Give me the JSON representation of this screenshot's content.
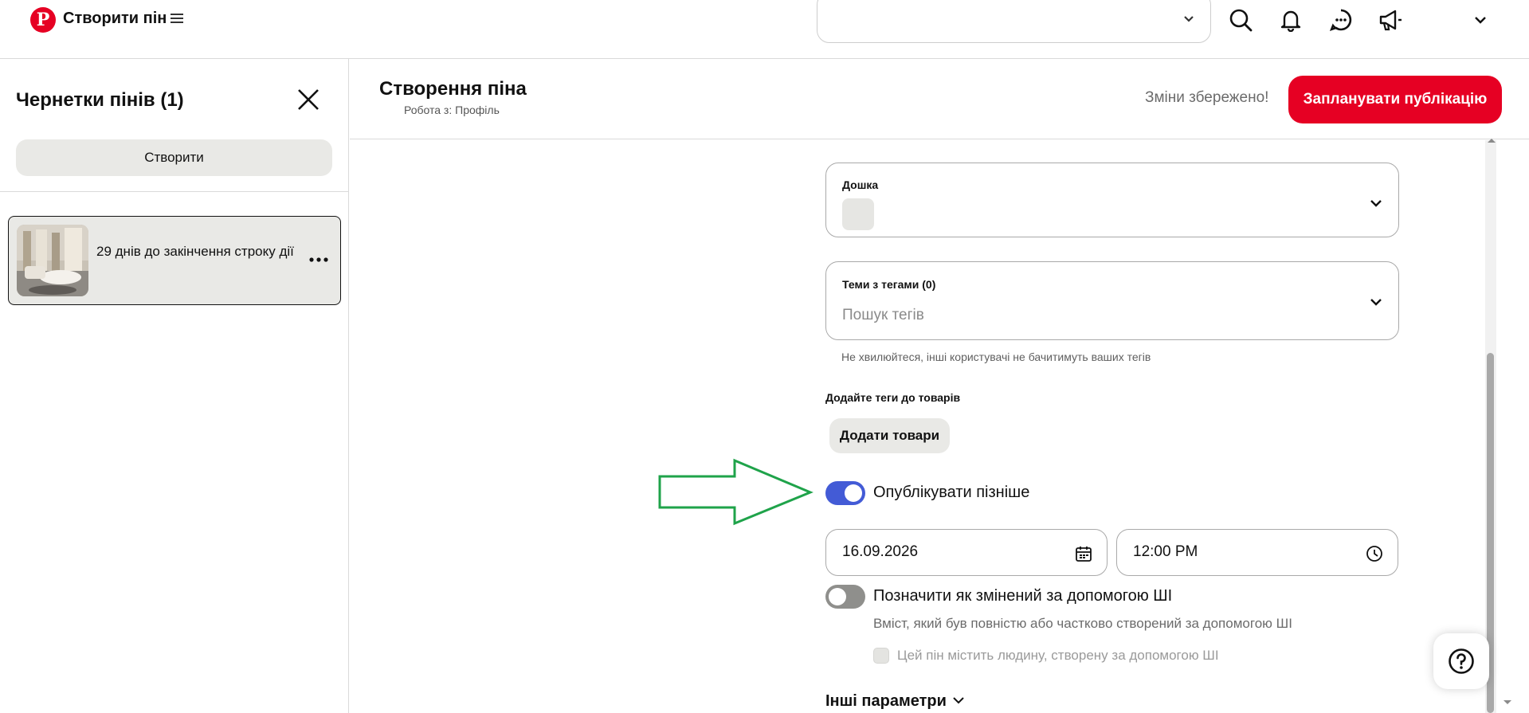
{
  "header": {
    "app_title": "Створити пін",
    "logo_letter": "P",
    "icons": [
      "search-icon",
      "bell-icon",
      "chat-icon",
      "megaphone-icon",
      "chevron-down-icon"
    ]
  },
  "drafts": {
    "title": "Чернетки пінів (1)",
    "create_label": "Створити",
    "items": [
      {
        "label": "29 днів до закінчення строку дії"
      }
    ]
  },
  "main": {
    "title": "Створення піна",
    "subtitle": "Робота з: Профіль",
    "saved_status": "Зміни збережено!",
    "publish_label": "Запланувати публікацію"
  },
  "form": {
    "board_label": "Дошка",
    "tags_label": "Теми з тегами (0)",
    "tags_placeholder": "Пошук тегів",
    "tags_helper": "Не хвилюйтеся, інші користувачі не бачитимуть ваших тегів",
    "products_label": "Додайте теги до товарів",
    "add_products_label": "Додати товари",
    "publish_later_label": "Опублікувати пізніше",
    "publish_later_on": true,
    "date_value": "16.09.2026",
    "time_value": "12:00 PM",
    "ai_label": "Позначити як змінений за допомогою ШІ",
    "ai_on": false,
    "ai_description": "Вміст, який був повністю або частково створений за допомогою ШІ",
    "ai_person_label": "Цей пін містить людину, створену за допомогою ШІ",
    "more_params_label": "Інші параметри"
  },
  "colors": {
    "brand_red": "#e60023",
    "toggle_on": "#435bd6",
    "annotation_arrow": "#1fa34a"
  }
}
